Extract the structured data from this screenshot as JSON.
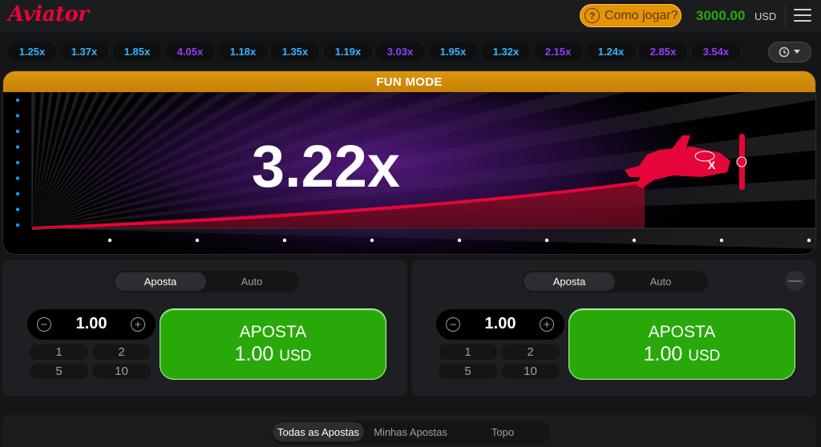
{
  "header": {
    "logo": "Aviator",
    "how_to_play": "Como jogar?",
    "balance": "3000.00",
    "currency": "USD"
  },
  "history": {
    "multipliers": [
      {
        "value": "1.25x",
        "color": "#34b4ff"
      },
      {
        "value": "1.37x",
        "color": "#34b4ff"
      },
      {
        "value": "1.85x",
        "color": "#34b4ff"
      },
      {
        "value": "4.05x",
        "color": "#913ef8"
      },
      {
        "value": "1.18x",
        "color": "#34b4ff"
      },
      {
        "value": "1.35x",
        "color": "#34b4ff"
      },
      {
        "value": "1.19x",
        "color": "#34b4ff"
      },
      {
        "value": "3.03x",
        "color": "#913ef8"
      },
      {
        "value": "1.95x",
        "color": "#34b4ff"
      },
      {
        "value": "1.32x",
        "color": "#34b4ff"
      },
      {
        "value": "2.15x",
        "color": "#913ef8"
      },
      {
        "value": "1.24x",
        "color": "#34b4ff"
      },
      {
        "value": "2.85x",
        "color": "#913ef8"
      },
      {
        "value": "3.54x",
        "color": "#913ef8"
      }
    ]
  },
  "game": {
    "mode_label": "FUN MODE",
    "multiplier": "3.22x",
    "curve_color": "#e50539",
    "plane_color": "#e50539"
  },
  "panels": [
    {
      "tab_bet": "Aposta",
      "tab_auto": "Auto",
      "amount": "1.00",
      "quick": [
        "1",
        "2",
        "5",
        "10"
      ],
      "button_label": "APOSTA",
      "button_amount": "1.00",
      "button_currency": "USD"
    },
    {
      "tab_bet": "Aposta",
      "tab_auto": "Auto",
      "amount": "1.00",
      "quick": [
        "1",
        "2",
        "5",
        "10"
      ],
      "button_label": "APOSTA",
      "button_amount": "1.00",
      "button_currency": "USD"
    }
  ],
  "bottom_tabs": [
    "Todas as Apostas",
    "Minhas Apostas",
    "Topo"
  ],
  "colors": {
    "accent_green": "#28a909",
    "accent_orange": "#e59407",
    "accent_red": "#e50539"
  }
}
